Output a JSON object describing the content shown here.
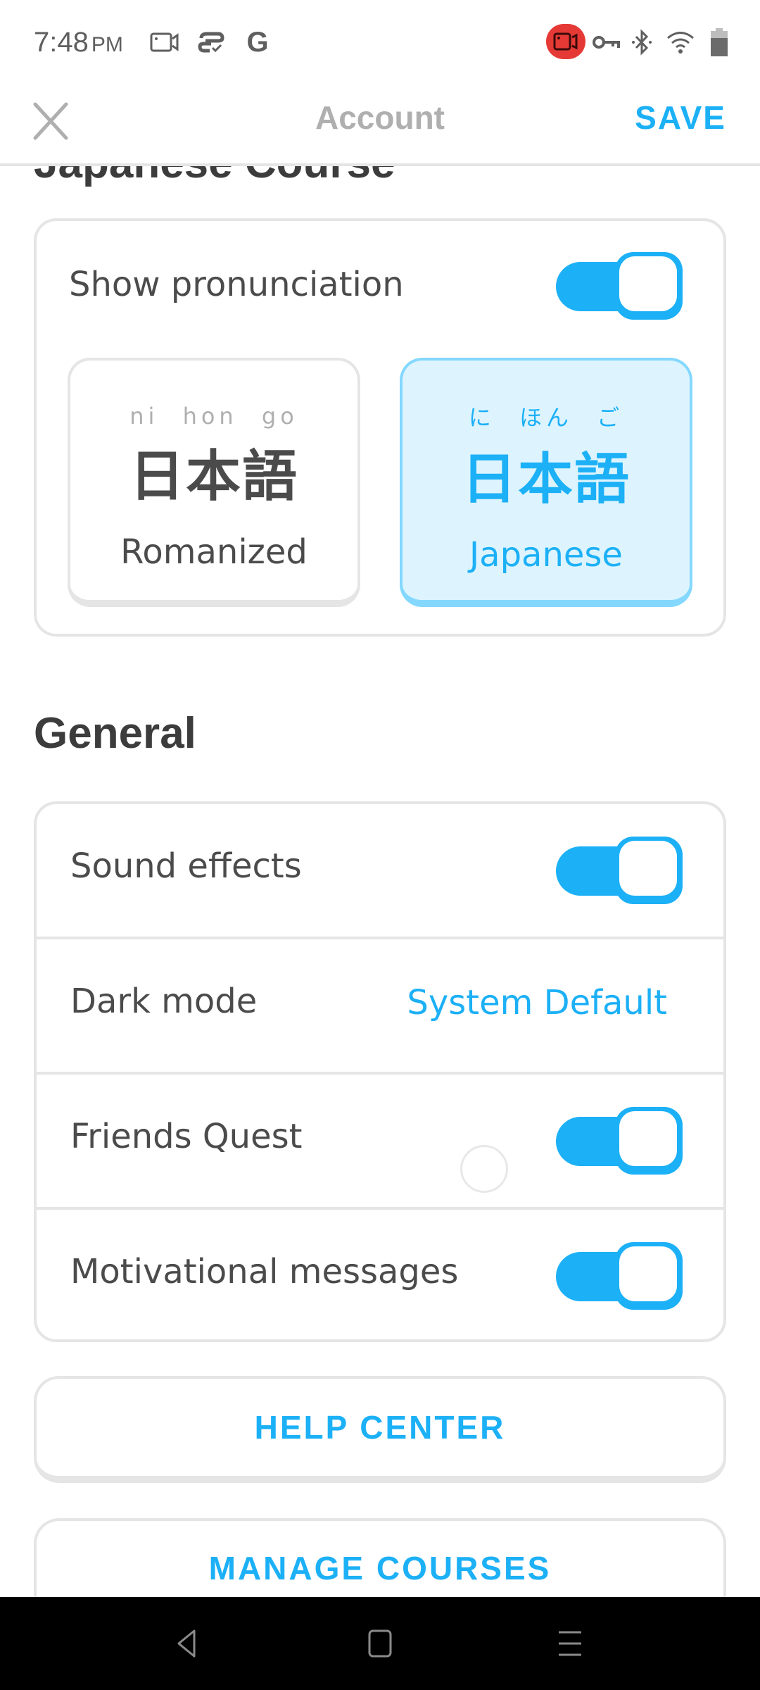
{
  "status_bar": {
    "time": "7:48",
    "ampm": "PM",
    "left_icons": [
      "screen-record-icon",
      "sync-icon",
      "google-icon"
    ],
    "google_glyph": "G",
    "right_icons": [
      "recording-indicator-icon",
      "vpn-key-icon",
      "bluetooth-icon",
      "wifi-icon",
      "battery-icon"
    ],
    "recording_color": "#e53935"
  },
  "app_bar": {
    "close_icon": "close-icon",
    "title": "Account",
    "save_label": "SAVE"
  },
  "japanese_course": {
    "section_title": "Japanese Course",
    "show_pronunciation": {
      "label": "Show pronunciation",
      "on": true
    },
    "options": [
      {
        "ruby": "ni hon go",
        "kanji": "日本語",
        "label": "Romanized",
        "selected": false
      },
      {
        "ruby": "に ほん ご",
        "kanji": "日本語",
        "label": "Japanese",
        "selected": true
      }
    ]
  },
  "general": {
    "section_title": "General",
    "rows": [
      {
        "label": "Sound effects",
        "type": "toggle",
        "on": true
      },
      {
        "label": "Dark mode",
        "type": "value",
        "value": "System Default"
      },
      {
        "label": "Friends Quest",
        "type": "toggle",
        "on": true
      },
      {
        "label": "Motivational messages",
        "type": "toggle",
        "on": true
      }
    ]
  },
  "buttons": {
    "help_center": "HELP CENTER",
    "manage_courses": "MANAGE COURSES"
  },
  "nav_bar": {
    "icons": [
      "back-icon",
      "home-icon",
      "recents-icon"
    ]
  },
  "colors": {
    "accent": "#1cb0f6",
    "selected_bg": "#ddf4ff",
    "selected_border": "#84d8ff",
    "border": "#e5e5e5",
    "text": "#4b4b4b",
    "muted": "#afafaf"
  }
}
